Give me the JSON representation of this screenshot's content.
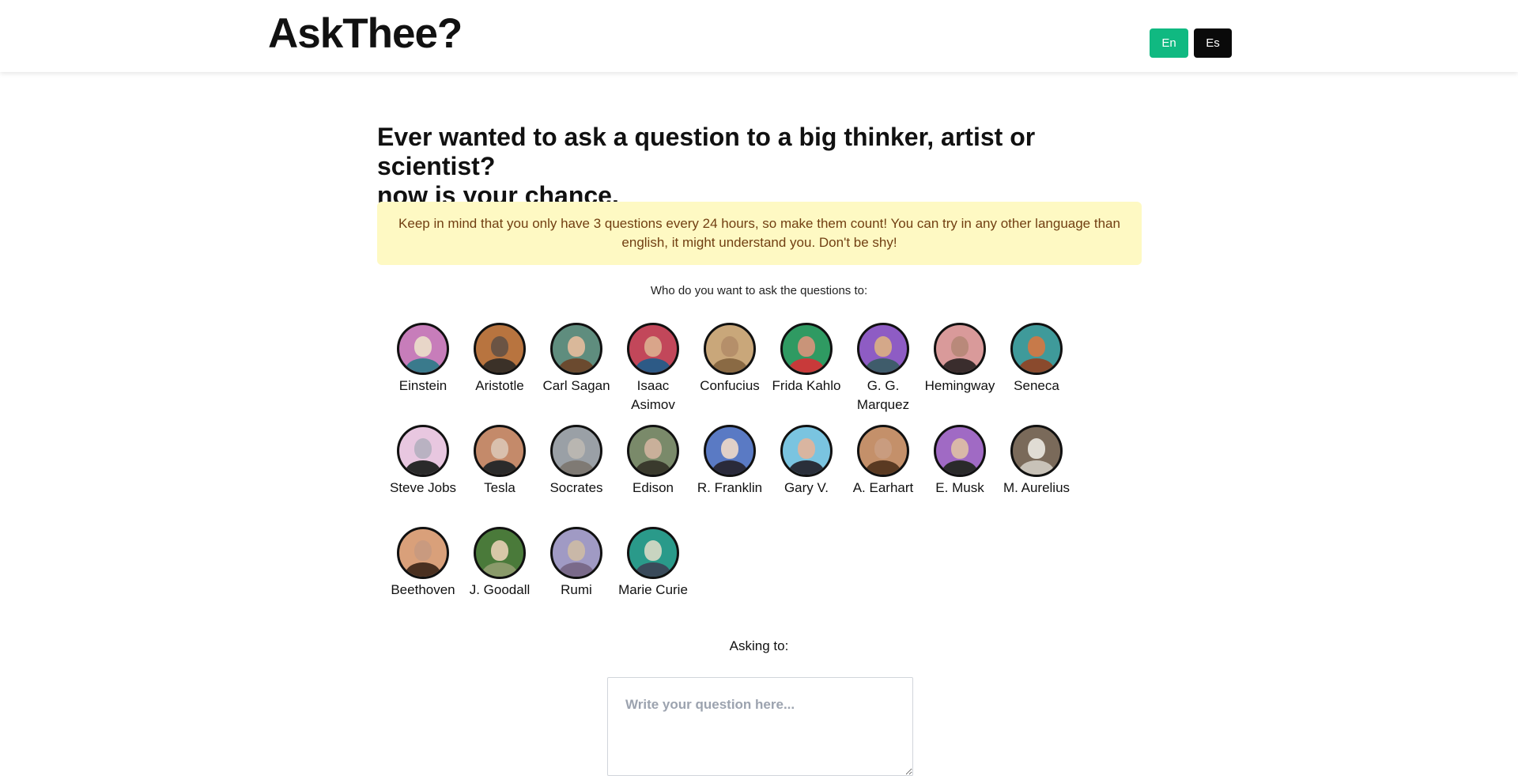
{
  "header": {
    "brand": "AskThee?",
    "languages": [
      "En",
      "Es"
    ],
    "colors": {
      "en_active": "#10b981",
      "es": "#0a0a0a"
    }
  },
  "main": {
    "headline_line1": "Ever wanted to ask a question to a big thinker, artist or scientist?",
    "headline_line2": "now is your chance.",
    "notice": "Keep in mind that you only have 3 questions every 24 hours, so make them count!  You can try in any other language than english, it might understand you. Don't be shy!",
    "who_prompt": "Who do you want to ask the questions to:",
    "asking_label": "Asking to:",
    "question_placeholder": "Write your question here..."
  },
  "people": [
    {
      "name": "Einstein",
      "bg": "#c77dba",
      "face": "#e8d6c8",
      "cloth": "#3a7a8c"
    },
    {
      "name": "Aristotle",
      "bg": "#b8743f",
      "face": "#6b5444",
      "cloth": "#3b3128"
    },
    {
      "name": "Carl Sagan",
      "bg": "#5f8d7e",
      "face": "#d9b89a",
      "cloth": "#6b4a2f"
    },
    {
      "name": "Isaac Asimov",
      "bg": "#c2475a",
      "face": "#d9a58a",
      "cloth": "#2d5a86"
    },
    {
      "name": "Confucius",
      "bg": "#c9a77a",
      "face": "#b58f6a",
      "cloth": "#8a6a44"
    },
    {
      "name": "Frida Kahlo",
      "bg": "#2f9a62",
      "face": "#c99479",
      "cloth": "#c83a3a"
    },
    {
      "name": "G. G. Marquez",
      "bg": "#8e5cc4",
      "face": "#d4a889",
      "cloth": "#3f5c6b"
    },
    {
      "name": "Hemingway",
      "bg": "#d99a9a",
      "face": "#b9897a",
      "cloth": "#3a2d2d"
    },
    {
      "name": "Seneca",
      "bg": "#3f9a9a",
      "face": "#c77a4a",
      "cloth": "#8a4a2d"
    },
    {
      "name": "Steve Jobs",
      "bg": "#e8c7e0",
      "face": "#b9b2c2",
      "cloth": "#2a2a2a"
    },
    {
      "name": "Tesla",
      "bg": "#c48a6a",
      "face": "#d9c0ad",
      "cloth": "#2b2b2b"
    },
    {
      "name": "Socrates",
      "bg": "#9aa0a6",
      "face": "#b9b6b1",
      "cloth": "#7f7a74"
    },
    {
      "name": "Edison",
      "bg": "#7a8a6a",
      "face": "#c9b09a",
      "cloth": "#3a3a2d"
    },
    {
      "name": "R. Franklin",
      "bg": "#5a7ac4",
      "face": "#e0d0c8",
      "cloth": "#2a2a3a"
    },
    {
      "name": "Gary V.",
      "bg": "#7ac4e0",
      "face": "#d9b5a0",
      "cloth": "#2a2f3a"
    },
    {
      "name": "A. Earhart",
      "bg": "#c4906a",
      "face": "#c99c7f",
      "cloth": "#5a3a22"
    },
    {
      "name": "E. Musk",
      "bg": "#a06ac4",
      "face": "#d9b8a8",
      "cloth": "#2a2a2a"
    },
    {
      "name": "M. Aurelius",
      "bg": "#7a6a5a",
      "face": "#e0dcd4",
      "cloth": "#c8c2b8"
    },
    {
      "name": "Beethoven",
      "bg": "#d9a07a",
      "face": "#c99a7f",
      "cloth": "#4a3020"
    },
    {
      "name": "J. Goodall",
      "bg": "#4a7a3a",
      "face": "#d8c8a8",
      "cloth": "#8a9a6a"
    },
    {
      "name": "Rumi",
      "bg": "#a09ac4",
      "face": "#c9b8a8",
      "cloth": "#7a6a8a"
    },
    {
      "name": "Marie Curie",
      "bg": "#2a9a8a",
      "face": "#c8d4c0",
      "cloth": "#3a4a5a"
    }
  ]
}
